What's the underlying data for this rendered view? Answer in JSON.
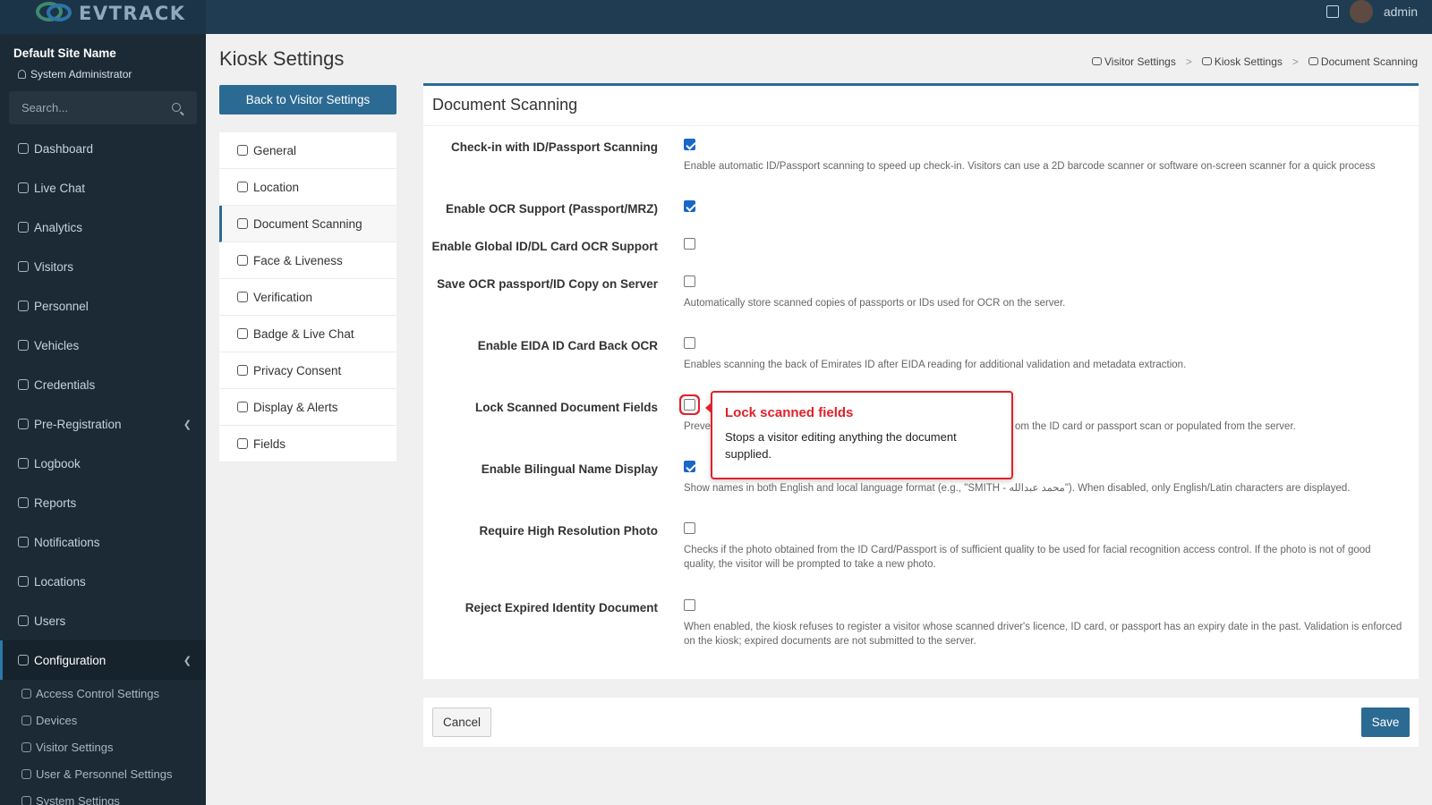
{
  "brand": {
    "logo_text": "EVTRACK"
  },
  "topbar": {
    "user_label": "admin"
  },
  "sidebar": {
    "site_name": "Default Site Name",
    "user_role": "System Administrator",
    "search_placeholder": "Search...",
    "items": [
      {
        "label": "Dashboard",
        "icon": "dashboard-icon"
      },
      {
        "label": "Live Chat",
        "icon": "headset-icon"
      },
      {
        "label": "Analytics",
        "icon": "analytics-icon"
      },
      {
        "label": "Visitors",
        "icon": "eye-icon"
      },
      {
        "label": "Personnel",
        "icon": "personnel-icon"
      },
      {
        "label": "Vehicles",
        "icon": "car-icon"
      },
      {
        "label": "Credentials",
        "icon": "credentials-icon"
      },
      {
        "label": "Pre-Registration",
        "icon": "arrows-icon"
      },
      {
        "label": "Logbook",
        "icon": "book-icon"
      },
      {
        "label": "Reports",
        "icon": "reports-icon"
      },
      {
        "label": "Notifications",
        "icon": "notifications-icon"
      },
      {
        "label": "Locations",
        "icon": "map-icon"
      },
      {
        "label": "Users",
        "icon": "users-icon"
      },
      {
        "label": "Configuration",
        "icon": "gear-icon"
      }
    ],
    "sub_items": [
      {
        "label": "Access Control Settings",
        "icon": "lock-icon"
      },
      {
        "label": "Devices",
        "icon": "device-icon"
      },
      {
        "label": "Visitor Settings",
        "icon": "eye-icon"
      },
      {
        "label": "User & Personnel Settings",
        "icon": "users-icon"
      },
      {
        "label": "System Settings",
        "icon": "gear-icon"
      }
    ]
  },
  "page": {
    "title": "Kiosk Settings",
    "back_label": "Back to Visitor Settings",
    "breadcrumb": [
      "Visitor Settings",
      "Kiosk Settings",
      "Document Scanning"
    ]
  },
  "subnav": [
    {
      "label": "General"
    },
    {
      "label": "Location"
    },
    {
      "label": "Document Scanning"
    },
    {
      "label": "Face & Liveness"
    },
    {
      "label": "Verification"
    },
    {
      "label": "Badge & Live Chat"
    },
    {
      "label": "Privacy Consent"
    },
    {
      "label": "Display & Alerts"
    },
    {
      "label": "Fields"
    }
  ],
  "panel": {
    "title": "Document Scanning",
    "rows": [
      {
        "label": "Check-in with ID/Passport Scanning",
        "checked": true,
        "desc": "Enable automatic ID/Passport scanning to speed up check-in. Visitors can use a 2D barcode scanner or software on-screen scanner for a quick process"
      },
      {
        "label": "Enable OCR Support (Passport/MRZ)",
        "checked": true,
        "desc": ""
      },
      {
        "label": "Enable Global ID/DL Card OCR Support",
        "checked": false,
        "desc": ""
      },
      {
        "label": "Save OCR passport/ID Copy on Server",
        "checked": false,
        "desc": "Automatically store scanned copies of passports or IDs used for OCR on the server."
      },
      {
        "label": "Enable EIDA ID Card Back OCR",
        "checked": false,
        "desc": "Enables scanning the back of Emirates ID after EIDA reading for additional validation and metadata extraction."
      },
      {
        "label": "Lock Scanned Document Fields",
        "checked": false,
        "desc_left": "Preve",
        "desc_right": "om the ID card or passport scan or populated from the server."
      },
      {
        "label": "Enable Bilingual Name Display",
        "checked": true,
        "desc": "Show names in both English and local language format (e.g., \"SMITH - محمد عبدالله\"). When disabled, only English/Latin characters are displayed."
      },
      {
        "label": "Require High Resolution Photo",
        "checked": false,
        "desc": "Checks if the photo obtained from the ID Card/Passport is of sufficient quality to be used for facial recognition access control. If the photo is not of good quality, the visitor will be prompted to take a new photo."
      },
      {
        "label": "Reject Expired Identity Document",
        "checked": false,
        "desc": "When enabled, the kiosk refuses to register a visitor whose scanned driver's licence, ID card, or passport has an expiry date in the past. Validation is enforced on the kiosk; expired documents are not submitted to the server."
      }
    ]
  },
  "tooltip": {
    "title": "Lock scanned fields",
    "body": "Stops a visitor editing anything the document supplied."
  },
  "footer": {
    "cancel_label": "Cancel",
    "save_label": "Save"
  },
  "colors": {
    "primary": "#2b6a93",
    "sidebar_bg": "#1c2a36",
    "topbar_bg": "#1f3c52",
    "checkbox_on": "#1a66c9",
    "tooltip_accent": "#e0212a"
  }
}
